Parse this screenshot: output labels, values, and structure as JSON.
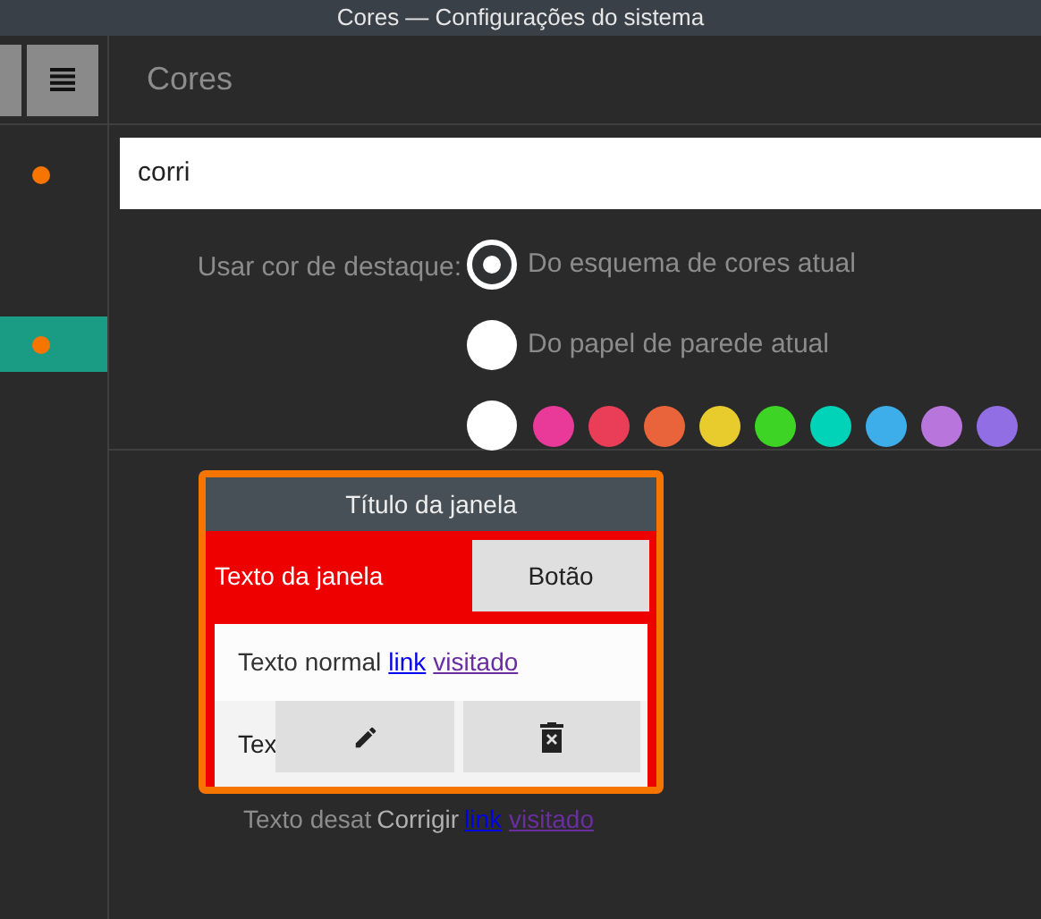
{
  "window": {
    "title": "Cores — Configurações do sistema"
  },
  "sidebar": {
    "items": [
      {
        "selected": false,
        "color": "#f67400"
      },
      {
        "selected": true,
        "color": "#f67400"
      }
    ]
  },
  "page": {
    "title": "Cores"
  },
  "search": {
    "value": "corri"
  },
  "accent": {
    "label": "Usar cor de destaque:",
    "options": [
      {
        "kind": "text",
        "label": "Do esquema de cores atual",
        "selected": true
      },
      {
        "kind": "text",
        "label": "Do papel de parede atual",
        "selected": false
      },
      {
        "kind": "swatches",
        "selected": false,
        "swatches": [
          {
            "color": "#e93a9a"
          },
          {
            "color": "#e93d58"
          },
          {
            "color": "#e9643a"
          },
          {
            "color": "#e8cb2d"
          },
          {
            "color": "#3dd425"
          },
          {
            "color": "#00d3b8"
          },
          {
            "color": "#3daee9"
          },
          {
            "color": "#b875dc"
          },
          {
            "color": "#926ee4"
          }
        ]
      }
    ]
  },
  "preview": {
    "title": "Título da janela",
    "window_text": "Texto da janela",
    "button": "Botão",
    "normal_text": "Texto normal",
    "link": "link",
    "visited": "visitado",
    "row_text_start": "Tex"
  },
  "below": {
    "disabled_text": "Texto desat",
    "fix": "Corrigir",
    "link": "link",
    "visited": "visitado"
  }
}
